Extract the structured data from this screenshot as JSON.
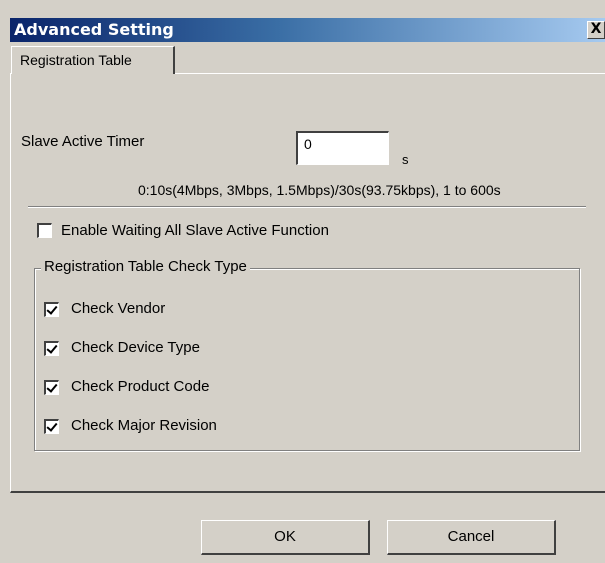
{
  "window": {
    "title": "Advanced Setting",
    "close_glyph": "X"
  },
  "tabs": [
    {
      "label": "Registration Table",
      "selected": true
    }
  ],
  "slave_active_timer": {
    "label": "Slave Active Timer",
    "value": "0",
    "unit": "s",
    "hint": "0:10s(4Mbps, 3Mbps, 1.5Mbps)/30s(93.75kbps), 1 to 600s"
  },
  "enable_waiting": {
    "label": "Enable Waiting All Slave Active Function",
    "checked": false
  },
  "check_type_group": {
    "caption": "Registration Table Check Type",
    "items": [
      {
        "label": "Check Vendor",
        "checked": true
      },
      {
        "label": "Check Device Type",
        "checked": true
      },
      {
        "label": "Check Product Code",
        "checked": true
      },
      {
        "label": "Check Major Revision",
        "checked": true
      }
    ]
  },
  "buttons": {
    "ok": "OK",
    "cancel": "Cancel"
  },
  "colors": {
    "title_start": "#0a246a",
    "title_end": "#a6caf0",
    "face": "#d4d0c8"
  }
}
